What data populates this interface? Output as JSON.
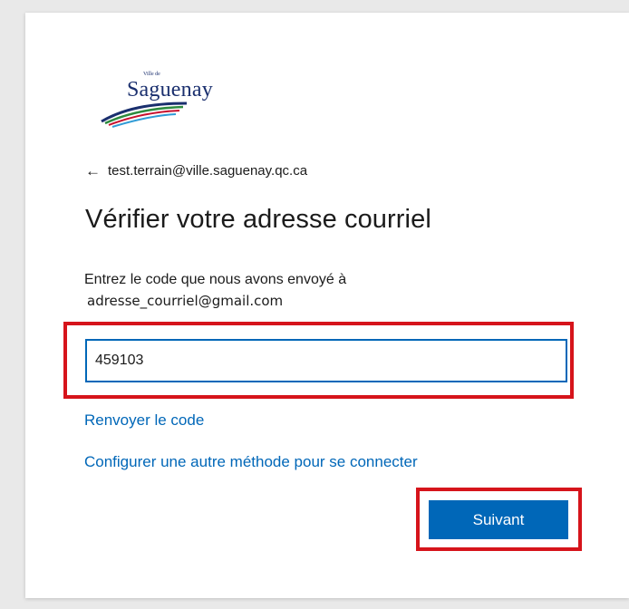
{
  "logo": {
    "small_text": "Ville de",
    "word": "Saguenay",
    "colors": [
      "#1a2f6e",
      "#2d8a3e",
      "#c8102e",
      "#2f9bd6"
    ]
  },
  "back": {
    "icon": "back-arrow-icon",
    "email": "test.terrain@ville.saguenay.qc.ca"
  },
  "title": "Vérifier votre adresse courriel",
  "instructions": {
    "line1": "Entrez le code que nous avons envoyé à",
    "email": "adresse_courriel@gmail.com"
  },
  "code_input": {
    "value": "459103"
  },
  "links": {
    "resend": "Renvoyer le code",
    "other_method": "Configurer une autre méthode pour se connecter"
  },
  "next_button": {
    "label": "Suivant"
  },
  "colors": {
    "accent": "#0067b8",
    "highlight": "#d6141b",
    "text": "#1b1b1b"
  }
}
